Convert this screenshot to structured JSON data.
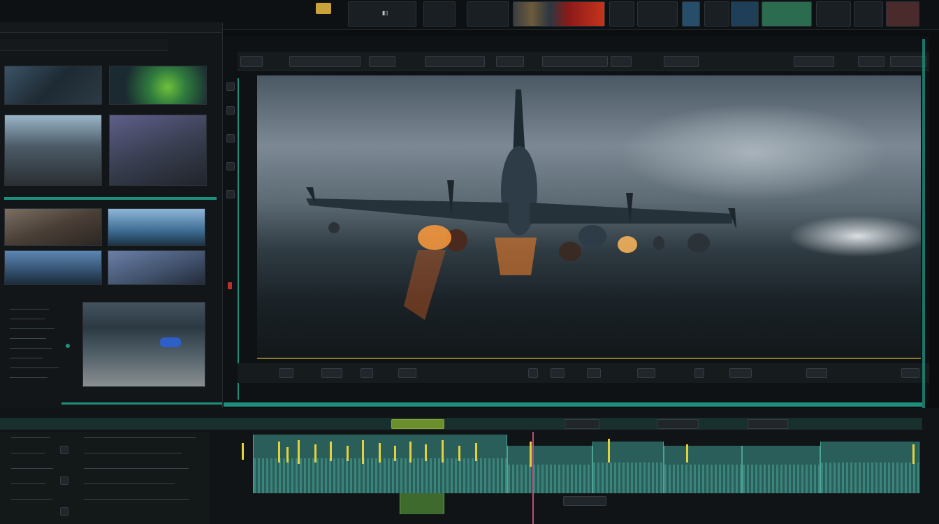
{
  "window": {
    "title": ""
  },
  "top_toolbar": {
    "tabs": [
      "",
      "",
      "",
      "",
      "",
      "",
      "",
      "",
      ""
    ]
  },
  "left_panel": {
    "header_label": "",
    "thumb_captions": [
      "",
      "",
      "",
      "",
      "",
      "",
      "",
      "",
      ""
    ],
    "list_items": [
      "",
      "",
      "",
      "",
      "",
      "",
      "",
      "",
      "",
      "",
      ""
    ]
  },
  "viewer": {
    "toolbar_buttons": [
      "",
      "",
      "",
      "",
      "",
      "",
      "",
      "",
      "",
      "",
      "",
      ""
    ],
    "transport": {
      "timecode_left": "",
      "timecode_right": "",
      "labels": [
        "",
        "",
        "",
        "",
        "",
        "",
        "",
        "",
        "",
        ""
      ]
    },
    "frame_description": ""
  },
  "timeline": {
    "header_labels": [
      "",
      "",
      "",
      "",
      "",
      ""
    ],
    "track_labels": [
      "",
      "",
      "",
      "",
      "",
      "",
      "",
      ""
    ],
    "highlight_label": ""
  },
  "colors": {
    "background": "#0b0d0f",
    "panel": "#15191c",
    "accent_teal": "#1f8f7d",
    "accent_yellow": "#e1d23b",
    "clip": "#2a5e5a"
  }
}
